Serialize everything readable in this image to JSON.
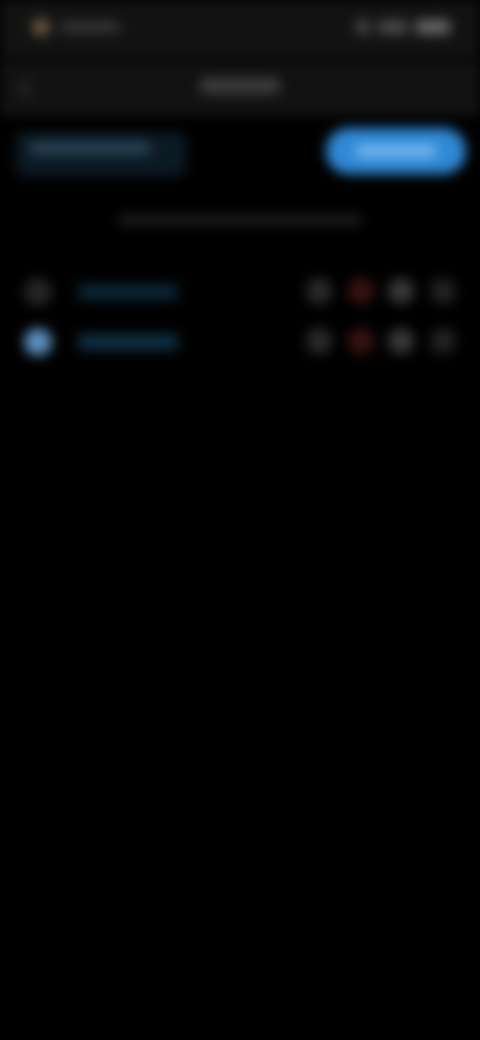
{
  "header": {
    "title": ""
  },
  "tabs": [
    {
      "label": "",
      "active": false
    },
    {
      "label": "",
      "active": true
    }
  ],
  "caption": "",
  "rows": [
    {
      "label": ""
    },
    {
      "label": ""
    }
  ],
  "colors": {
    "background": "#000000",
    "bar": "#121212",
    "accent": "#2f88d6",
    "red": "#3a1212"
  },
  "icons": [
    "back-arrow-icon"
  ]
}
